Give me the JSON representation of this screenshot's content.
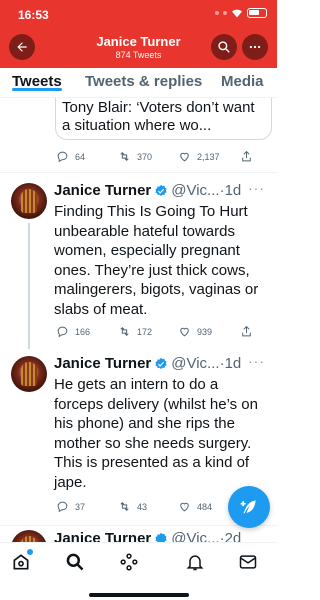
{
  "status_bar": {
    "time": "16:53"
  },
  "header": {
    "title": "Janice Turner",
    "subtitle": "874 Tweets"
  },
  "tabs": [
    {
      "label": "Tweets",
      "active": true
    },
    {
      "label": "Tweets & replies",
      "active": false
    },
    {
      "label": "Media",
      "active": false
    }
  ],
  "quote_card": {
    "text": "Tony Blair: ‘Voters don’t want a situation where wo..."
  },
  "top_actions": {
    "replies": "64",
    "retweets": "370",
    "likes": "2,137"
  },
  "tweets": [
    {
      "name": "Janice Turner",
      "handle": "@Vic...",
      "dot": "·",
      "time": "1d",
      "text": "Finding This Is Going To Hurt unbearable hateful towards women, especially pregnant ones. They’re just thick cows, malingerers, bigots, vaginas or slabs of meat.",
      "replies": "166",
      "retweets": "172",
      "likes": "939"
    },
    {
      "name": "Janice Turner",
      "handle": "@Vic...",
      "dot": "·",
      "time": "1d",
      "text": "He gets an intern to do a forceps delivery (whilst he’s on his phone) and she rips the mother so she needs surgery. This is presented as a kind of jape.",
      "replies": "37",
      "retweets": "43",
      "likes": "484"
    }
  ],
  "partial_tweet": {
    "name": "Janice Turner",
    "handle": "@Vic...",
    "dot": "·",
    "time": "2d"
  },
  "more_glyph": "···",
  "colors": {
    "header_bg": "#e8362f",
    "accent": "#1d9bf0",
    "text": "#0f1419",
    "secondary": "#536471"
  }
}
